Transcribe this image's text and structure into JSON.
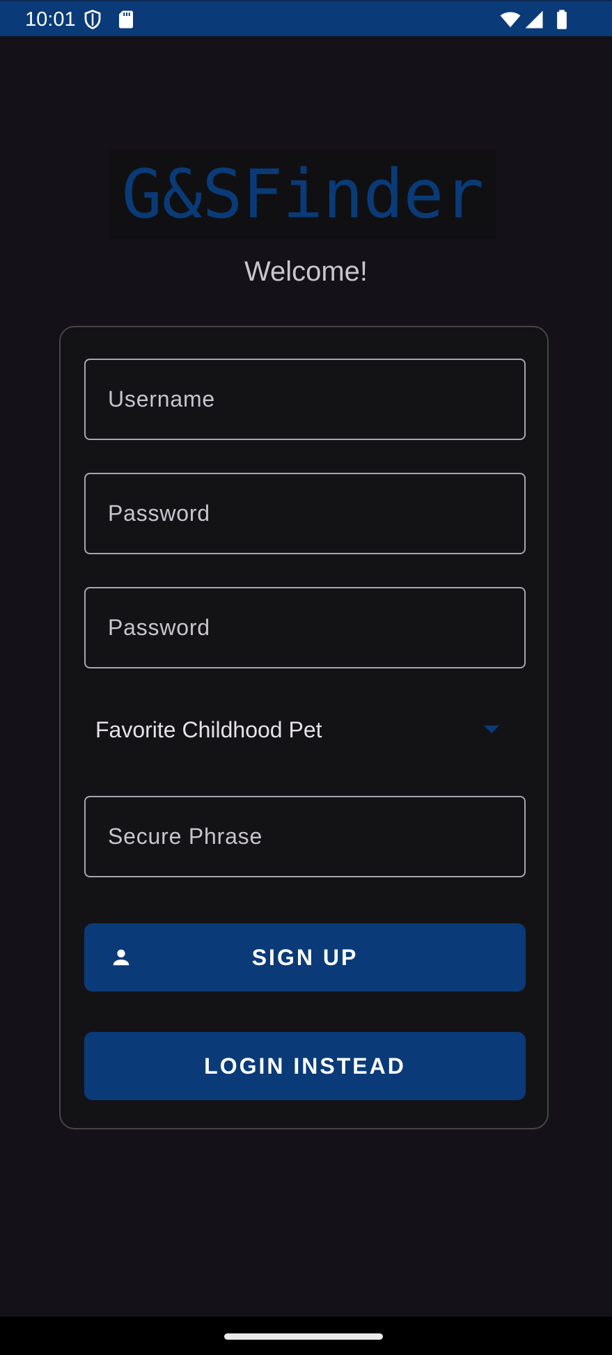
{
  "status_bar": {
    "time": "10:01",
    "icons": [
      "shield-icon",
      "sd-card-icon",
      "wifi-icon",
      "signal-icon",
      "battery-icon"
    ]
  },
  "app": {
    "logo": "G&SFinder",
    "welcome": "Welcome!"
  },
  "form": {
    "username_placeholder": "Username",
    "password_placeholder": "Password",
    "confirm_password_placeholder": "Password",
    "security_question": "Favorite Childhood Pet",
    "secure_phrase_placeholder": "Secure Phrase",
    "signup_label": "SIGN UP",
    "login_label": "LOGIN INSTEAD"
  },
  "colors": {
    "brand": "#0a3b78",
    "background": "#141218",
    "text": "#c9c5cc"
  }
}
